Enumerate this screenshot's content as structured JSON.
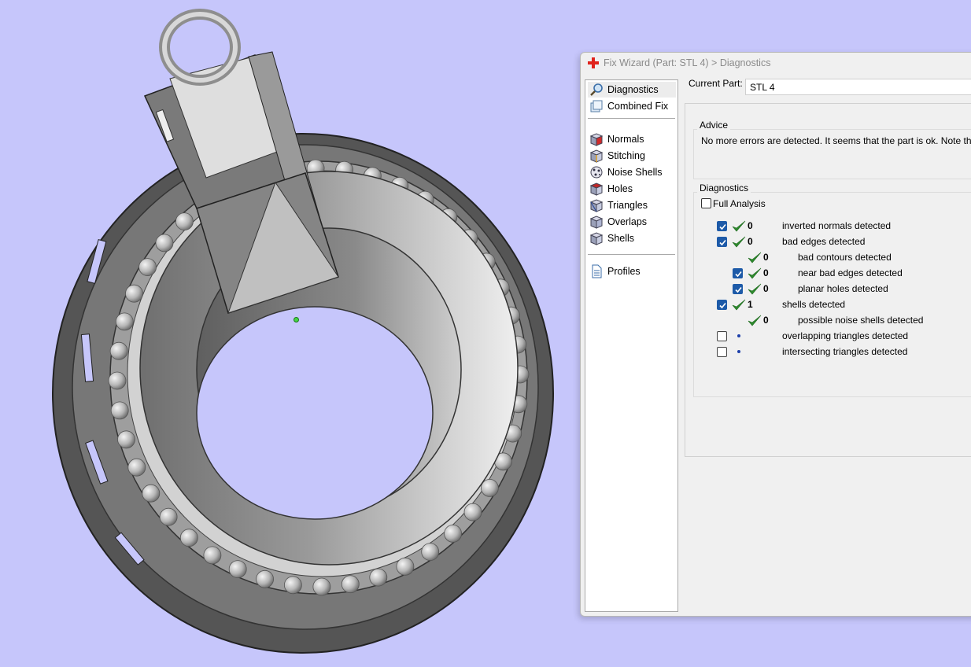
{
  "window": {
    "title": "Fix Wizard (Part: STL 4) > Diagnostics",
    "icon": "red-cross-icon"
  },
  "nav": {
    "items": [
      {
        "label": "Diagnostics",
        "icon": "magnifier-icon",
        "selected": true
      },
      {
        "label": "Combined Fix",
        "icon": "combined-fix-icon"
      },
      {
        "label": "Normals",
        "icon": "normals-cube-icon"
      },
      {
        "label": "Stitching",
        "icon": "stitching-cube-icon"
      },
      {
        "label": "Noise Shells",
        "icon": "noise-shells-icon"
      },
      {
        "label": "Holes",
        "icon": "holes-cube-icon"
      },
      {
        "label": "Triangles",
        "icon": "triangles-cube-icon"
      },
      {
        "label": "Overlaps",
        "icon": "overlaps-cube-icon"
      },
      {
        "label": "Shells",
        "icon": "shells-cube-icon"
      },
      {
        "label": "Profiles",
        "icon": "document-icon"
      }
    ]
  },
  "current_part": {
    "label": "Current Part:",
    "value": "STL 4"
  },
  "advice": {
    "title": "Advice",
    "text": "No more errors are detected. It seems that the part is ok. Note that no"
  },
  "diagnostics": {
    "title": "Diagnostics",
    "full_analysis_label": "Full Analysis",
    "full_analysis_checked": false,
    "rows": [
      {
        "checkbox": "on",
        "status": "ok",
        "count": "0",
        "label": "inverted normals detected",
        "indent": 0
      },
      {
        "checkbox": "on",
        "status": "ok",
        "count": "0",
        "label": "bad edges detected",
        "indent": 0
      },
      {
        "checkbox": "none",
        "status": "ok",
        "count": "0",
        "label": "bad contours detected",
        "indent": 1
      },
      {
        "checkbox": "on",
        "status": "ok",
        "count": "0",
        "label": "near bad edges detected",
        "indent": 1
      },
      {
        "checkbox": "on",
        "status": "ok",
        "count": "0",
        "label": "planar holes detected",
        "indent": 1
      },
      {
        "checkbox": "on",
        "status": "ok",
        "count": "1",
        "label": "shells detected",
        "indent": 0
      },
      {
        "checkbox": "none",
        "status": "ok",
        "count": "0",
        "label": "possible noise shells detected",
        "indent": 1
      },
      {
        "checkbox": "off",
        "status": "pending",
        "count": "",
        "label": "overlapping triangles detected",
        "indent": 0
      },
      {
        "checkbox": "off",
        "status": "pending",
        "count": "",
        "label": "intersecting triangles detected",
        "indent": 0
      }
    ]
  },
  "colors": {
    "background": "#c6c6fb",
    "check_green": "#2e8b2e",
    "checkbox_blue": "#1d5aa8",
    "model_grey": "#8a8a8a"
  }
}
